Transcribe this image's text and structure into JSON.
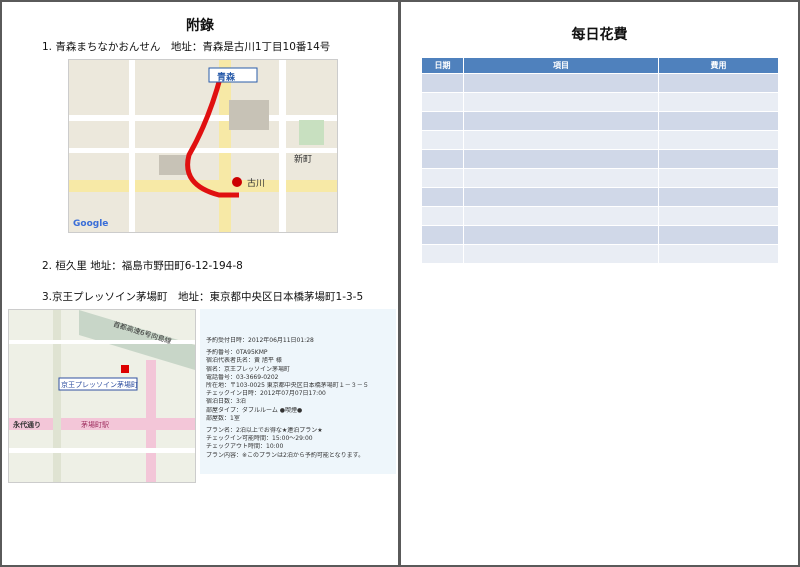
{
  "left_page": {
    "title": "附錄",
    "item1": "1. 青森まちなかおんせん　地址：青森是古川1丁目10番14号",
    "item2": "2. 桓久里  地址：福島市野田町6-12-194-8",
    "item3": "3.京王プレッソイン茅場町　地址：東京都中央区日本橋茅場町1-3-5",
    "map1": {
      "station": "青森",
      "area1": "新町",
      "area2": "古川",
      "brand": "Google"
    },
    "map2": {
      "highway": "首都高速6号向島線",
      "street": "永代通り",
      "station": "茅場町駅",
      "hotel": "京王プレッソイン茅場町"
    },
    "booking": [
      "予約受付日時：2012年06月11日01:28",
      "予約番号：0TA95KMP",
      "宿泊代表者氏名：黄 旭平 様",
      "宿名：京王プレッソイン茅場町",
      "電話番号：03-3669-0202",
      "所在地：〒103-0025 東京都中央区日本橋茅場町１－３－５",
      "チェックイン日時：2012年07月07日17:00",
      "宿泊日数：3泊",
      "部屋タイプ：ダブルルーム ●喫煙●",
      "部屋数：1室",
      "プラン名：2泊以上でお得な★連泊プラン★",
      "チェックイン可能時間：15:00～29:00",
      "チェックアウト時間：10:00",
      "プラン内容：※このプランは2泊から予約可能となります。"
    ]
  },
  "right_page": {
    "title": "每日花費",
    "table": {
      "headers": [
        "日期",
        "項目",
        "費用"
      ],
      "rows": [
        [
          "",
          "",
          ""
        ],
        [
          "",
          "",
          ""
        ],
        [
          "",
          "",
          ""
        ],
        [
          "",
          "",
          ""
        ],
        [
          "",
          "",
          ""
        ],
        [
          "",
          "",
          ""
        ],
        [
          "",
          "",
          ""
        ],
        [
          "",
          "",
          ""
        ],
        [
          "",
          "",
          ""
        ],
        [
          "",
          "",
          ""
        ]
      ]
    }
  },
  "colors": {
    "table_header": "#4f81bd",
    "row_odd": "#d0d8e8",
    "row_even": "#e9edf4",
    "route": "#e01010"
  }
}
